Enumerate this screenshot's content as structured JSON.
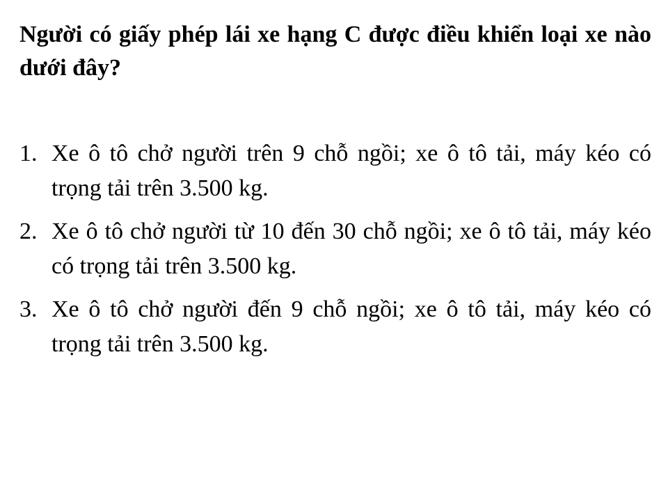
{
  "question": "Người có giấy phép lái xe hạng C được điều khiển loại xe nào dưới đây?",
  "answers": [
    {
      "number": "1.",
      "text": "Xe ô tô chở người trên 9 chỗ ngồi; xe ô tô tải, máy kéo có trọng tải trên 3.500 kg."
    },
    {
      "number": "2.",
      "text": "Xe ô tô chở người từ 10 đến 30 chỗ ngồi; xe ô tô tải, máy kéo có trọng tải trên 3.500 kg."
    },
    {
      "number": "3.",
      "text": "Xe ô tô chở người đến 9 chỗ ngồi; xe ô tô tải, máy kéo có trọng tải trên 3.500 kg."
    }
  ]
}
